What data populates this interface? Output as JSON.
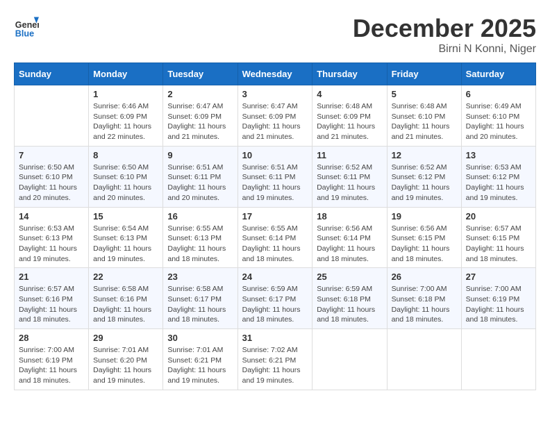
{
  "header": {
    "logo_general": "General",
    "logo_blue": "Blue",
    "month_title": "December 2025",
    "location": "Birni N Konni, Niger"
  },
  "columns": [
    "Sunday",
    "Monday",
    "Tuesday",
    "Wednesday",
    "Thursday",
    "Friday",
    "Saturday"
  ],
  "weeks": [
    [
      {
        "day": "",
        "sunrise": "",
        "sunset": "",
        "daylight": ""
      },
      {
        "day": "1",
        "sunrise": "Sunrise: 6:46 AM",
        "sunset": "Sunset: 6:09 PM",
        "daylight": "Daylight: 11 hours and 22 minutes."
      },
      {
        "day": "2",
        "sunrise": "Sunrise: 6:47 AM",
        "sunset": "Sunset: 6:09 PM",
        "daylight": "Daylight: 11 hours and 21 minutes."
      },
      {
        "day": "3",
        "sunrise": "Sunrise: 6:47 AM",
        "sunset": "Sunset: 6:09 PM",
        "daylight": "Daylight: 11 hours and 21 minutes."
      },
      {
        "day": "4",
        "sunrise": "Sunrise: 6:48 AM",
        "sunset": "Sunset: 6:09 PM",
        "daylight": "Daylight: 11 hours and 21 minutes."
      },
      {
        "day": "5",
        "sunrise": "Sunrise: 6:48 AM",
        "sunset": "Sunset: 6:10 PM",
        "daylight": "Daylight: 11 hours and 21 minutes."
      },
      {
        "day": "6",
        "sunrise": "Sunrise: 6:49 AM",
        "sunset": "Sunset: 6:10 PM",
        "daylight": "Daylight: 11 hours and 20 minutes."
      }
    ],
    [
      {
        "day": "7",
        "sunrise": "Sunrise: 6:50 AM",
        "sunset": "Sunset: 6:10 PM",
        "daylight": "Daylight: 11 hours and 20 minutes."
      },
      {
        "day": "8",
        "sunrise": "Sunrise: 6:50 AM",
        "sunset": "Sunset: 6:10 PM",
        "daylight": "Daylight: 11 hours and 20 minutes."
      },
      {
        "day": "9",
        "sunrise": "Sunrise: 6:51 AM",
        "sunset": "Sunset: 6:11 PM",
        "daylight": "Daylight: 11 hours and 20 minutes."
      },
      {
        "day": "10",
        "sunrise": "Sunrise: 6:51 AM",
        "sunset": "Sunset: 6:11 PM",
        "daylight": "Daylight: 11 hours and 19 minutes."
      },
      {
        "day": "11",
        "sunrise": "Sunrise: 6:52 AM",
        "sunset": "Sunset: 6:11 PM",
        "daylight": "Daylight: 11 hours and 19 minutes."
      },
      {
        "day": "12",
        "sunrise": "Sunrise: 6:52 AM",
        "sunset": "Sunset: 6:12 PM",
        "daylight": "Daylight: 11 hours and 19 minutes."
      },
      {
        "day": "13",
        "sunrise": "Sunrise: 6:53 AM",
        "sunset": "Sunset: 6:12 PM",
        "daylight": "Daylight: 11 hours and 19 minutes."
      }
    ],
    [
      {
        "day": "14",
        "sunrise": "Sunrise: 6:53 AM",
        "sunset": "Sunset: 6:13 PM",
        "daylight": "Daylight: 11 hours and 19 minutes."
      },
      {
        "day": "15",
        "sunrise": "Sunrise: 6:54 AM",
        "sunset": "Sunset: 6:13 PM",
        "daylight": "Daylight: 11 hours and 19 minutes."
      },
      {
        "day": "16",
        "sunrise": "Sunrise: 6:55 AM",
        "sunset": "Sunset: 6:13 PM",
        "daylight": "Daylight: 11 hours and 18 minutes."
      },
      {
        "day": "17",
        "sunrise": "Sunrise: 6:55 AM",
        "sunset": "Sunset: 6:14 PM",
        "daylight": "Daylight: 11 hours and 18 minutes."
      },
      {
        "day": "18",
        "sunrise": "Sunrise: 6:56 AM",
        "sunset": "Sunset: 6:14 PM",
        "daylight": "Daylight: 11 hours and 18 minutes."
      },
      {
        "day": "19",
        "sunrise": "Sunrise: 6:56 AM",
        "sunset": "Sunset: 6:15 PM",
        "daylight": "Daylight: 11 hours and 18 minutes."
      },
      {
        "day": "20",
        "sunrise": "Sunrise: 6:57 AM",
        "sunset": "Sunset: 6:15 PM",
        "daylight": "Daylight: 11 hours and 18 minutes."
      }
    ],
    [
      {
        "day": "21",
        "sunrise": "Sunrise: 6:57 AM",
        "sunset": "Sunset: 6:16 PM",
        "daylight": "Daylight: 11 hours and 18 minutes."
      },
      {
        "day": "22",
        "sunrise": "Sunrise: 6:58 AM",
        "sunset": "Sunset: 6:16 PM",
        "daylight": "Daylight: 11 hours and 18 minutes."
      },
      {
        "day": "23",
        "sunrise": "Sunrise: 6:58 AM",
        "sunset": "Sunset: 6:17 PM",
        "daylight": "Daylight: 11 hours and 18 minutes."
      },
      {
        "day": "24",
        "sunrise": "Sunrise: 6:59 AM",
        "sunset": "Sunset: 6:17 PM",
        "daylight": "Daylight: 11 hours and 18 minutes."
      },
      {
        "day": "25",
        "sunrise": "Sunrise: 6:59 AM",
        "sunset": "Sunset: 6:18 PM",
        "daylight": "Daylight: 11 hours and 18 minutes."
      },
      {
        "day": "26",
        "sunrise": "Sunrise: 7:00 AM",
        "sunset": "Sunset: 6:18 PM",
        "daylight": "Daylight: 11 hours and 18 minutes."
      },
      {
        "day": "27",
        "sunrise": "Sunrise: 7:00 AM",
        "sunset": "Sunset: 6:19 PM",
        "daylight": "Daylight: 11 hours and 18 minutes."
      }
    ],
    [
      {
        "day": "28",
        "sunrise": "Sunrise: 7:00 AM",
        "sunset": "Sunset: 6:19 PM",
        "daylight": "Daylight: 11 hours and 18 minutes."
      },
      {
        "day": "29",
        "sunrise": "Sunrise: 7:01 AM",
        "sunset": "Sunset: 6:20 PM",
        "daylight": "Daylight: 11 hours and 19 minutes."
      },
      {
        "day": "30",
        "sunrise": "Sunrise: 7:01 AM",
        "sunset": "Sunset: 6:21 PM",
        "daylight": "Daylight: 11 hours and 19 minutes."
      },
      {
        "day": "31",
        "sunrise": "Sunrise: 7:02 AM",
        "sunset": "Sunset: 6:21 PM",
        "daylight": "Daylight: 11 hours and 19 minutes."
      },
      {
        "day": "",
        "sunrise": "",
        "sunset": "",
        "daylight": ""
      },
      {
        "day": "",
        "sunrise": "",
        "sunset": "",
        "daylight": ""
      },
      {
        "day": "",
        "sunrise": "",
        "sunset": "",
        "daylight": ""
      }
    ]
  ]
}
